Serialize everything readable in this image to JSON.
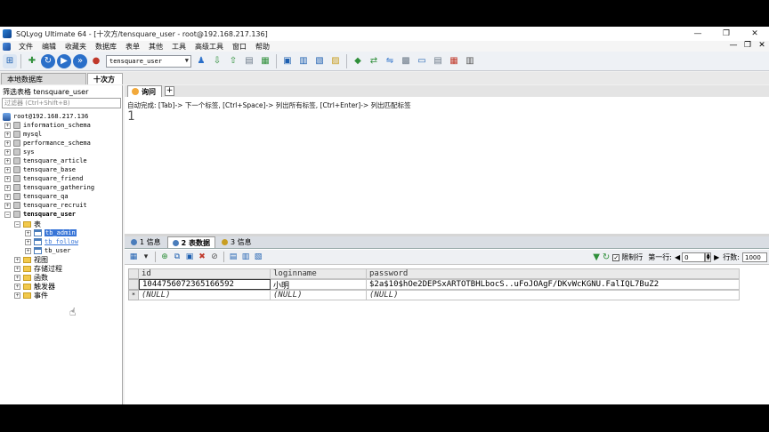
{
  "window": {
    "title": "SQLyog Ultimate 64 - [十次方/tensquare_user - root@192.168.217.136]",
    "minimize": "—",
    "restore": "❐",
    "close": "✕"
  },
  "menu": {
    "items": [
      "文件",
      "编辑",
      "收藏夹",
      "数据库",
      "表单",
      "其他",
      "工具",
      "高级工具",
      "窗口",
      "帮助"
    ],
    "right": [
      "—",
      "❐",
      "✕"
    ]
  },
  "toolbar": {
    "database_selected": "tensquare_user"
  },
  "connection_tabs": {
    "tab1": "本地数据库",
    "tab2": "十次方"
  },
  "object_browser": {
    "filter_label": "筛选表格 tensquare_user",
    "filter_placeholder": "过滤器 (Ctrl+Shift+B)",
    "server": "root@192.168.217.136",
    "databases": [
      "information_schema",
      "mysql",
      "performance_schema",
      "sys",
      "tensquare_article",
      "tensquare_base",
      "tensquare_friend",
      "tensquare_gathering",
      "tensquare_qa",
      "tensquare_recruit",
      "tensquare_user"
    ],
    "folder_tables": "表",
    "tables": [
      "tb_admin",
      "tb_follow",
      "tb_user"
    ],
    "folders": [
      "视图",
      "存储过程",
      "函数",
      "触发器",
      "事件"
    ]
  },
  "query_editor": {
    "tab_label": "询问",
    "add_tab": "+",
    "hint": "自动完成: [Tab]-> 下一个标签, [Ctrl+Space]-> 列出所有标签, [Ctrl+Enter]-> 列出匹配标签",
    "line_number": "1"
  },
  "results": {
    "tabs": [
      "1 信息",
      "2 表数据",
      "3 信息"
    ],
    "limit_label": "限制行",
    "first_row_label": "第一行:",
    "first_row_value": "0",
    "rows_label": "行数:",
    "rows_value": "1000",
    "columns": [
      "id",
      "loginname",
      "password"
    ],
    "rows": [
      [
        "1044756072365166592",
        "小明",
        "$2a$10$hOe2DEPSxARTOTBHLbocS..uFoJOAgF/DKvWcKGNU.FalIQL7BuZ2"
      ],
      [
        "(NULL)",
        "(NULL)",
        "(NULL)"
      ]
    ],
    "new_row_marker": "*"
  }
}
